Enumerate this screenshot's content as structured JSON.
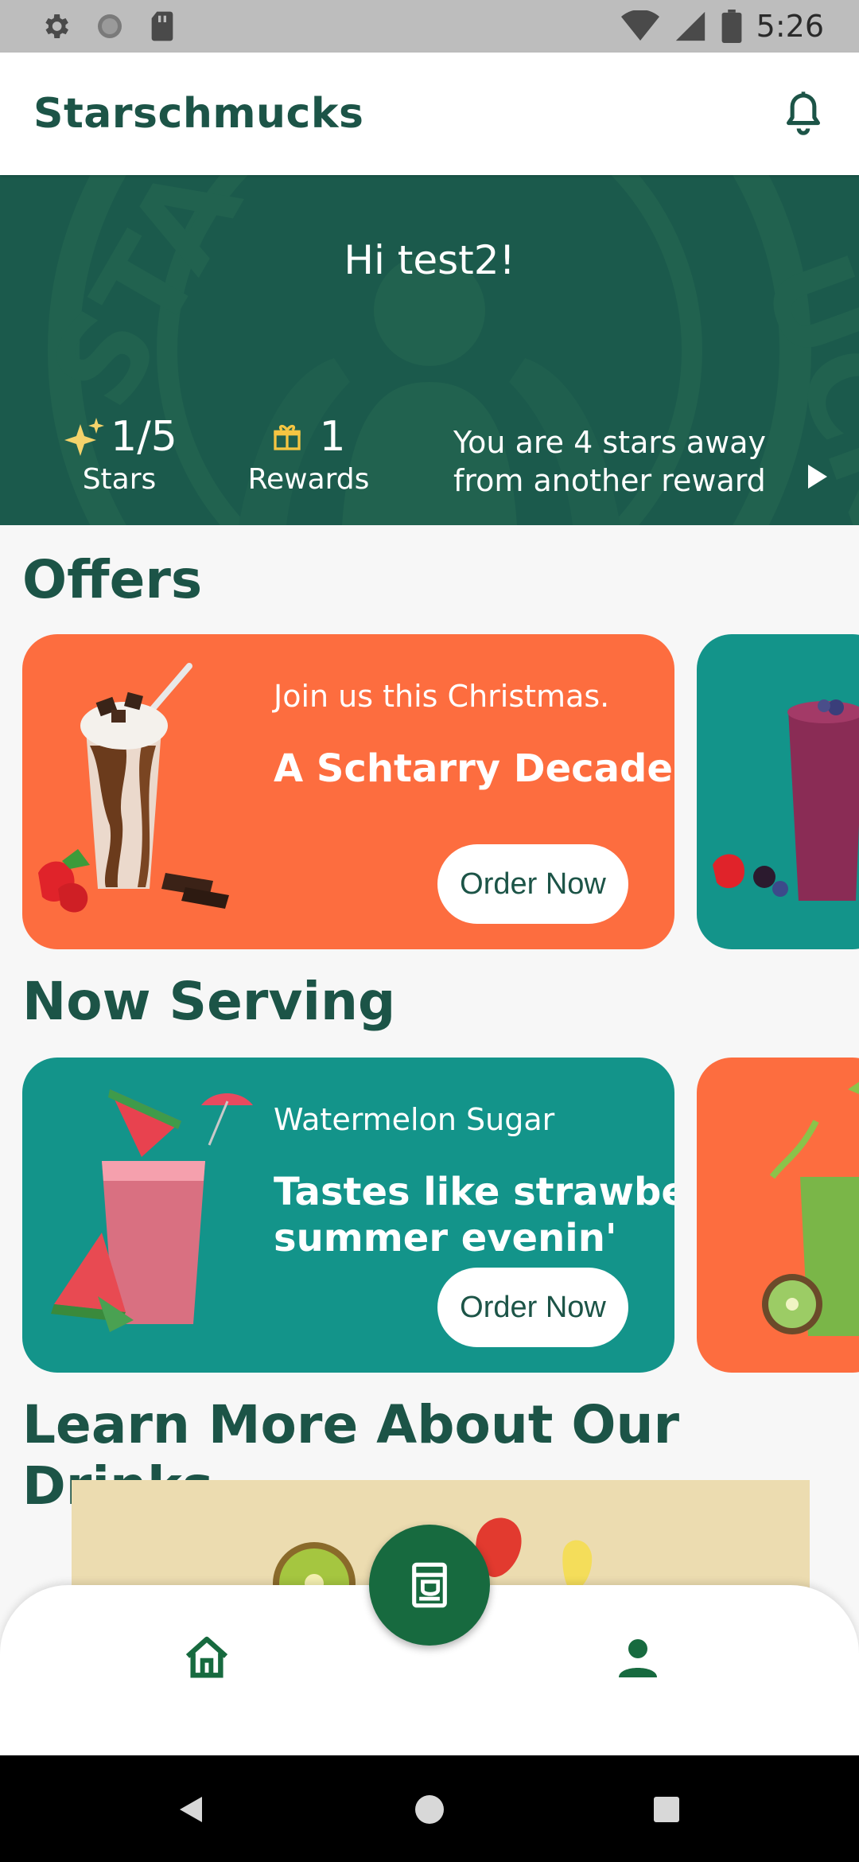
{
  "status_bar": {
    "time": "5:26",
    "icons": [
      "settings-icon",
      "sync-icon",
      "sd-card-icon",
      "wifi-icon",
      "signal-icon",
      "battery-icon"
    ]
  },
  "app_bar": {
    "title": "Starschmucks",
    "icons": [
      "bell-icon"
    ]
  },
  "hero": {
    "greeting": "Hi test2!",
    "stars_value": "1/5",
    "stars_label": "Stars",
    "rewards_value": "1",
    "rewards_label": "Rewards",
    "reward_message_line1": "You are 4 stars away",
    "reward_message_line2": "from another reward",
    "icons": [
      "sparkle-icon",
      "gift-icon",
      "play-arrow-icon"
    ]
  },
  "offers": {
    "title": "Offers",
    "cards": [
      {
        "subtitle": "Join us this Christmas.",
        "headline": "A Schtarry Decade",
        "button": "Order Now",
        "color": "#fd6d3f"
      },
      {
        "color": "#13948a"
      }
    ]
  },
  "now_serving": {
    "title": "Now Serving",
    "cards": [
      {
        "subtitle": "Watermelon Sugar",
        "headline": "Tastes like strawberries\nsummer evenin'",
        "button": "Order Now",
        "color": "#13948a"
      },
      {
        "color": "#fd6d3f"
      }
    ]
  },
  "learn_more": {
    "title": "Learn More About Our Drinks"
  },
  "bottom_nav": {
    "icons": [
      "home-icon",
      "coffee-machine-icon",
      "profile-icon"
    ]
  },
  "colors": {
    "brand_green": "#1c5447",
    "hero_bg": "#1b5a4c",
    "fab_green": "#176a3f",
    "orange": "#fd6d3f",
    "teal": "#13948a"
  }
}
